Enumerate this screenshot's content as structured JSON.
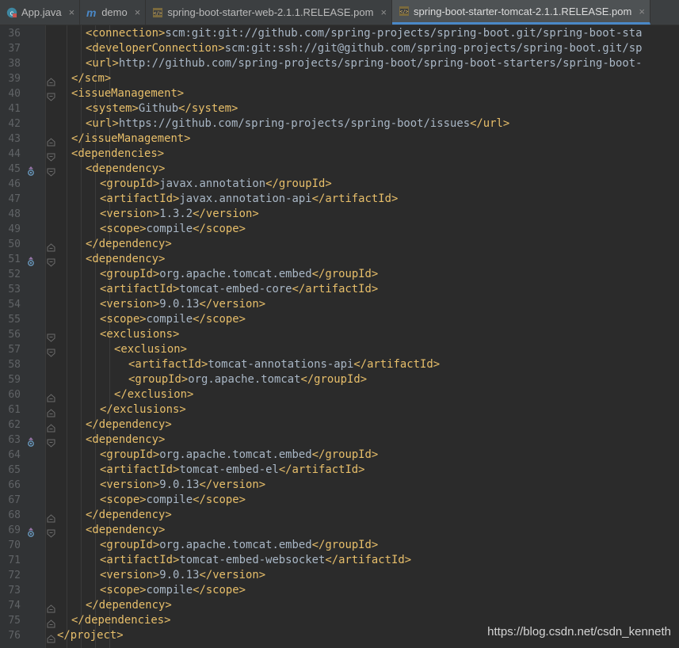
{
  "tabs": [
    {
      "label": "App.java",
      "icon": "java-class-icon",
      "active": false
    },
    {
      "label": "demo",
      "icon": "maven-module-icon",
      "active": false
    },
    {
      "label": "spring-boot-starter-web-2.1.1.RELEASE.pom",
      "icon": "xml-file-icon",
      "active": false
    },
    {
      "label": "spring-boot-starter-tomcat-2.1.1.RELEASE.pom",
      "icon": "xml-file-icon",
      "active": true
    }
  ],
  "colors": {
    "tag": "#e8bf6a",
    "text": "#a9b7c6",
    "line_number": "#606366",
    "background": "#2b2b2b",
    "accent": "#4a88c7"
  },
  "lines": [
    {
      "num": "36",
      "indent": 2,
      "parts": [
        [
          "t",
          "<connection>"
        ],
        [
          "x",
          "scm:git:git://github.com/spring-projects/spring-boot.git/spring-boot-sta"
        ]
      ]
    },
    {
      "num": "37",
      "indent": 2,
      "parts": [
        [
          "t",
          "<developerConnection>"
        ],
        [
          "x",
          "scm:git:ssh://git@github.com/spring-projects/spring-boot.git/sp"
        ]
      ]
    },
    {
      "num": "38",
      "indent": 2,
      "parts": [
        [
          "t",
          "<url>"
        ],
        [
          "x",
          "http://github.com/spring-projects/spring-boot/spring-boot-starters/spring-boot-"
        ]
      ]
    },
    {
      "num": "39",
      "indent": 1,
      "fold": "end",
      "parts": [
        [
          "t",
          "</scm>"
        ]
      ]
    },
    {
      "num": "40",
      "indent": 1,
      "fold": "start",
      "parts": [
        [
          "t",
          "<issueManagement>"
        ]
      ]
    },
    {
      "num": "41",
      "indent": 2,
      "parts": [
        [
          "t",
          "<system>"
        ],
        [
          "x",
          "Github"
        ],
        [
          "t",
          "</system>"
        ]
      ]
    },
    {
      "num": "42",
      "indent": 2,
      "parts": [
        [
          "t",
          "<url>"
        ],
        [
          "x",
          "https://github.com/spring-projects/spring-boot/issues"
        ],
        [
          "t",
          "</url>"
        ]
      ]
    },
    {
      "num": "43",
      "indent": 1,
      "fold": "end",
      "parts": [
        [
          "t",
          "</issueManagement>"
        ]
      ]
    },
    {
      "num": "44",
      "indent": 1,
      "fold": "start",
      "parts": [
        [
          "t",
          "<dependencies>"
        ]
      ]
    },
    {
      "num": "45",
      "indent": 2,
      "fold": "start",
      "marker": true,
      "parts": [
        [
          "t",
          "<dependency>"
        ]
      ]
    },
    {
      "num": "46",
      "indent": 3,
      "parts": [
        [
          "t",
          "<groupId>"
        ],
        [
          "x",
          "javax.annotation"
        ],
        [
          "t",
          "</groupId>"
        ]
      ]
    },
    {
      "num": "47",
      "indent": 3,
      "parts": [
        [
          "t",
          "<artifactId>"
        ],
        [
          "x",
          "javax.annotation-api"
        ],
        [
          "t",
          "</artifactId>"
        ]
      ]
    },
    {
      "num": "48",
      "indent": 3,
      "parts": [
        [
          "t",
          "<version>"
        ],
        [
          "x",
          "1.3.2"
        ],
        [
          "t",
          "</version>"
        ]
      ]
    },
    {
      "num": "49",
      "indent": 3,
      "parts": [
        [
          "t",
          "<scope>"
        ],
        [
          "x",
          "compile"
        ],
        [
          "t",
          "</scope>"
        ]
      ]
    },
    {
      "num": "50",
      "indent": 2,
      "fold": "end",
      "parts": [
        [
          "t",
          "</dependency>"
        ]
      ]
    },
    {
      "num": "51",
      "indent": 2,
      "fold": "start",
      "marker": true,
      "parts": [
        [
          "t",
          "<dependency>"
        ]
      ]
    },
    {
      "num": "52",
      "indent": 3,
      "parts": [
        [
          "t",
          "<groupId>"
        ],
        [
          "x",
          "org.apache.tomcat.embed"
        ],
        [
          "t",
          "</groupId>"
        ]
      ]
    },
    {
      "num": "53",
      "indent": 3,
      "parts": [
        [
          "t",
          "<artifactId>"
        ],
        [
          "x",
          "tomcat-embed-core"
        ],
        [
          "t",
          "</artifactId>"
        ]
      ]
    },
    {
      "num": "54",
      "indent": 3,
      "parts": [
        [
          "t",
          "<version>"
        ],
        [
          "x",
          "9.0.13"
        ],
        [
          "t",
          "</version>"
        ]
      ]
    },
    {
      "num": "55",
      "indent": 3,
      "parts": [
        [
          "t",
          "<scope>"
        ],
        [
          "x",
          "compile"
        ],
        [
          "t",
          "</scope>"
        ]
      ]
    },
    {
      "num": "56",
      "indent": 3,
      "fold": "start",
      "parts": [
        [
          "t",
          "<exclusions>"
        ]
      ]
    },
    {
      "num": "57",
      "indent": 4,
      "fold": "start",
      "parts": [
        [
          "t",
          "<exclusion>"
        ]
      ]
    },
    {
      "num": "58",
      "indent": 5,
      "parts": [
        [
          "t",
          "<artifactId>"
        ],
        [
          "x",
          "tomcat-annotations-api"
        ],
        [
          "t",
          "</artifactId>"
        ]
      ]
    },
    {
      "num": "59",
      "indent": 5,
      "parts": [
        [
          "t",
          "<groupId>"
        ],
        [
          "x",
          "org.apache.tomcat"
        ],
        [
          "t",
          "</groupId>"
        ]
      ]
    },
    {
      "num": "60",
      "indent": 4,
      "fold": "end",
      "parts": [
        [
          "t",
          "</exclusion>"
        ]
      ]
    },
    {
      "num": "61",
      "indent": 3,
      "fold": "end",
      "parts": [
        [
          "t",
          "</exclusions>"
        ]
      ]
    },
    {
      "num": "62",
      "indent": 2,
      "fold": "end",
      "parts": [
        [
          "t",
          "</dependency>"
        ]
      ]
    },
    {
      "num": "63",
      "indent": 2,
      "fold": "start",
      "marker": true,
      "parts": [
        [
          "t",
          "<dependency>"
        ]
      ]
    },
    {
      "num": "64",
      "indent": 3,
      "parts": [
        [
          "t",
          "<groupId>"
        ],
        [
          "x",
          "org.apache.tomcat.embed"
        ],
        [
          "t",
          "</groupId>"
        ]
      ]
    },
    {
      "num": "65",
      "indent": 3,
      "parts": [
        [
          "t",
          "<artifactId>"
        ],
        [
          "x",
          "tomcat-embed-el"
        ],
        [
          "t",
          "</artifactId>"
        ]
      ]
    },
    {
      "num": "66",
      "indent": 3,
      "parts": [
        [
          "t",
          "<version>"
        ],
        [
          "x",
          "9.0.13"
        ],
        [
          "t",
          "</version>"
        ]
      ]
    },
    {
      "num": "67",
      "indent": 3,
      "parts": [
        [
          "t",
          "<scope>"
        ],
        [
          "x",
          "compile"
        ],
        [
          "t",
          "</scope>"
        ]
      ]
    },
    {
      "num": "68",
      "indent": 2,
      "fold": "end",
      "parts": [
        [
          "t",
          "</dependency>"
        ]
      ]
    },
    {
      "num": "69",
      "indent": 2,
      "fold": "start",
      "marker": true,
      "parts": [
        [
          "t",
          "<dependency>"
        ]
      ]
    },
    {
      "num": "70",
      "indent": 3,
      "parts": [
        [
          "t",
          "<groupId>"
        ],
        [
          "x",
          "org.apache.tomcat.embed"
        ],
        [
          "t",
          "</groupId>"
        ]
      ]
    },
    {
      "num": "71",
      "indent": 3,
      "parts": [
        [
          "t",
          "<artifactId>"
        ],
        [
          "x",
          "tomcat-embed-websocket"
        ],
        [
          "t",
          "</artifactId>"
        ]
      ]
    },
    {
      "num": "72",
      "indent": 3,
      "parts": [
        [
          "t",
          "<version>"
        ],
        [
          "x",
          "9.0.13"
        ],
        [
          "t",
          "</version>"
        ]
      ]
    },
    {
      "num": "73",
      "indent": 3,
      "parts": [
        [
          "t",
          "<scope>"
        ],
        [
          "x",
          "compile"
        ],
        [
          "t",
          "</scope>"
        ]
      ]
    },
    {
      "num": "74",
      "indent": 2,
      "fold": "end",
      "parts": [
        [
          "t",
          "</dependency>"
        ]
      ]
    },
    {
      "num": "75",
      "indent": 1,
      "fold": "end",
      "parts": [
        [
          "t",
          "</dependencies>"
        ]
      ]
    },
    {
      "num": "76",
      "indent": 0,
      "fold": "end",
      "parts": [
        [
          "t",
          "</project>"
        ]
      ]
    }
  ],
  "watermark": "https://blog.csdn.net/csdn_kenneth"
}
